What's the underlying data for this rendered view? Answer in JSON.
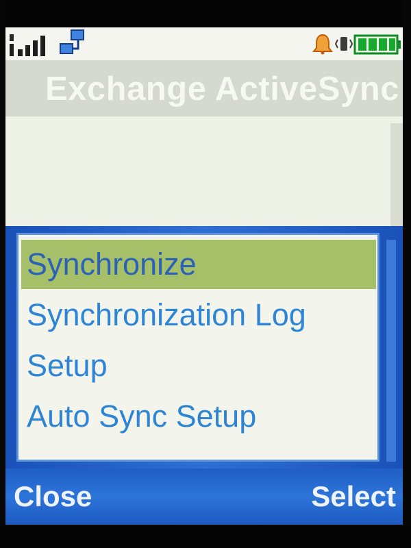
{
  "status_bar": {
    "icons": [
      "signal-strength-icon",
      "network-connection-icon",
      "alarm-icon",
      "vibrate-icon",
      "battery-icon"
    ],
    "signal_bars": 4,
    "battery_level": 1.0
  },
  "app": {
    "title": "Exchange ActiveSync"
  },
  "menu": {
    "items": [
      {
        "label": "Synchronize",
        "selected": true
      },
      {
        "label": "Synchronization Log",
        "selected": false
      },
      {
        "label": "Setup",
        "selected": false
      },
      {
        "label": "Auto Sync Setup",
        "selected": false
      }
    ]
  },
  "softkeys": {
    "left": "Close",
    "right": "Select"
  },
  "colors": {
    "screen_bg": "#eef2e6",
    "menu_frame": "#2e6fd2",
    "menu_text": "#2f85d5",
    "selected_bg": "#a6c06a",
    "softkey_bar": "#2d74d9",
    "alarm": "#e07a10",
    "battery": "#19a82f"
  }
}
